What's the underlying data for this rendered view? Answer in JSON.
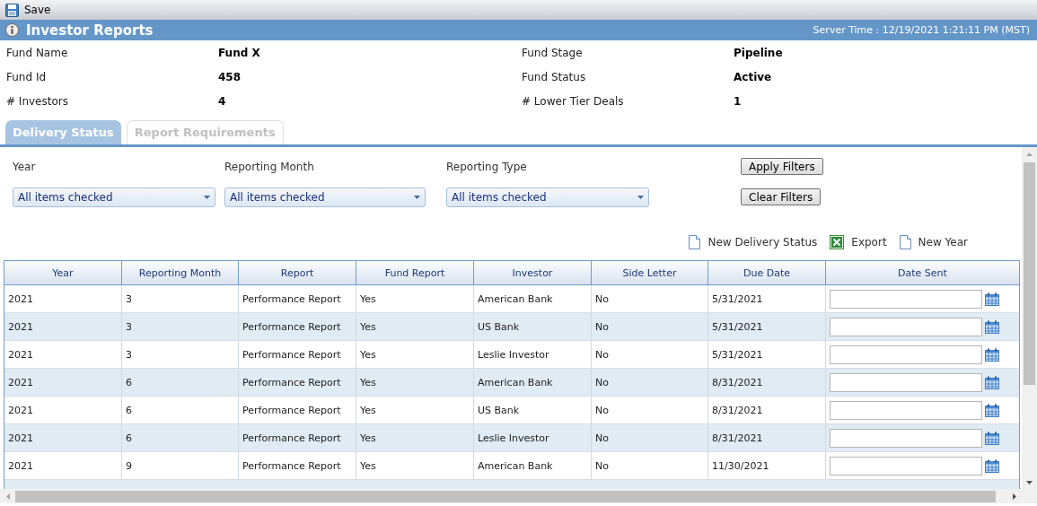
{
  "toolbar": {
    "save": "Save"
  },
  "header": {
    "title": "Investor Reports",
    "server_time": "Server Time : 12/19/2021 1:21:11 PM (MST)"
  },
  "fund_info": [
    {
      "label": "Fund Name",
      "value": "Fund X"
    },
    {
      "label": "Fund Stage",
      "value": "Pipeline"
    },
    {
      "label": "Fund Id",
      "value": "458"
    },
    {
      "label": "Fund Status",
      "value": "Active"
    },
    {
      "label": "# Investors",
      "value": "4"
    },
    {
      "label": "# Lower Tier Deals",
      "value": "1"
    }
  ],
  "tabs": [
    {
      "label": "Delivery Status",
      "selected": true
    },
    {
      "label": "Report Requirements",
      "selected": false
    }
  ],
  "filters": [
    {
      "label": "Year",
      "value": "All items checked"
    },
    {
      "label": "Reporting Month",
      "value": "All items checked"
    },
    {
      "label": "Reporting Type",
      "value": "All items checked"
    }
  ],
  "buttons": [
    "Apply Filters",
    "Clear Filters"
  ],
  "actions": [
    {
      "label": "New Delivery Status",
      "kind": "page"
    },
    {
      "label": "Export",
      "kind": "excel"
    },
    {
      "label": "New Year",
      "kind": "page"
    }
  ],
  "table": {
    "columns": [
      "Year",
      "Reporting Month",
      "Report",
      "Fund Report",
      "Investor",
      "Side Letter",
      "Due Date",
      "Date Sent"
    ],
    "rows": [
      [
        "2021",
        "3",
        "Performance Report",
        "Yes",
        "American Bank",
        "No",
        "5/31/2021"
      ],
      [
        "2021",
        "3",
        "Performance Report",
        "Yes",
        "US Bank",
        "No",
        "5/31/2021"
      ],
      [
        "2021",
        "3",
        "Performance Report",
        "Yes",
        "Leslie Investor",
        "No",
        "5/31/2021"
      ],
      [
        "2021",
        "6",
        "Performance Report",
        "Yes",
        "American Bank",
        "No",
        "8/31/2021"
      ],
      [
        "2021",
        "6",
        "Performance Report",
        "Yes",
        "US Bank",
        "No",
        "8/31/2021"
      ],
      [
        "2021",
        "6",
        "Performance Report",
        "Yes",
        "Leslie Investor",
        "No",
        "8/31/2021"
      ],
      [
        "2021",
        "9",
        "Performance Report",
        "Yes",
        "American Bank",
        "No",
        "11/30/2021"
      ]
    ]
  }
}
